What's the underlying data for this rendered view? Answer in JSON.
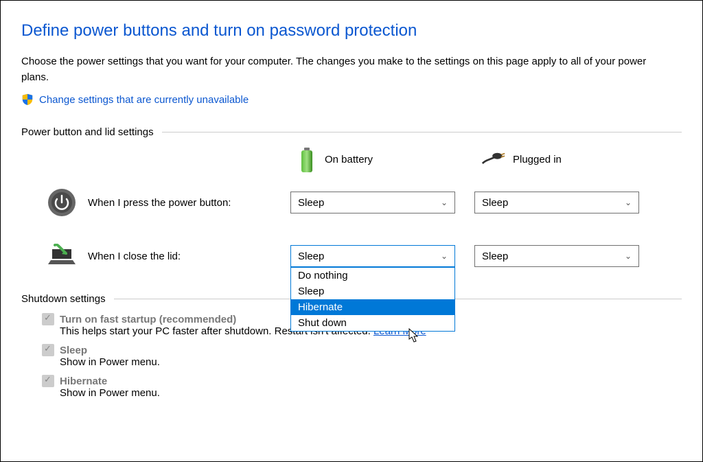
{
  "title": "Define power buttons and turn on password protection",
  "description": "Choose the power settings that you want for your computer. The changes you make to the settings on this page apply to all of your power plans.",
  "uac_link": "Change settings that are currently unavailable",
  "sections": {
    "power_lid": {
      "label": "Power button and lid settings",
      "columns": {
        "battery": "On battery",
        "plugged": "Plugged in"
      },
      "rows": {
        "power_button": {
          "label": "When I press the power button:",
          "battery_value": "Sleep",
          "plugged_value": "Sleep"
        },
        "close_lid": {
          "label": "When I close the lid:",
          "battery_value": "Sleep",
          "plugged_value": "Sleep"
        }
      },
      "dropdown_options": [
        "Do nothing",
        "Sleep",
        "Hibernate",
        "Shut down"
      ],
      "highlighted_option": "Hibernate"
    },
    "shutdown": {
      "label": "Shutdown settings",
      "items": {
        "fast_startup": {
          "label": "Turn on fast startup (recommended)",
          "desc_pre": "This helps start your PC faster after shutdown. Restart isn't affected. ",
          "learn_more": "Learn More"
        },
        "sleep": {
          "label": "Sleep",
          "desc": "Show in Power menu."
        },
        "hibernate": {
          "label": "Hibernate",
          "desc": "Show in Power menu."
        }
      }
    }
  }
}
